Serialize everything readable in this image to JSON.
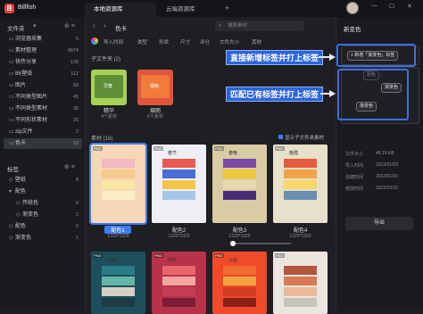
{
  "app": {
    "name": "Billfish",
    "logo": "B"
  },
  "tabs": [
    {
      "label": "本地资源库"
    },
    {
      "label": "云端资源库"
    }
  ],
  "window": {
    "add": "+",
    "min": "—",
    "max": "☐",
    "close": "✕"
  },
  "sidebar": {
    "folders_header": "文件夹",
    "folders_caret": "▾",
    "header_actions": "⊕ ≡",
    "folders": [
      {
        "label": "浏览器采集",
        "count": "5"
      },
      {
        "label": "素材整理",
        "count": "4874"
      },
      {
        "label": "快传分享",
        "count": "139"
      },
      {
        "label": "8K壁纸",
        "count": "112"
      },
      {
        "label": "图片",
        "count": "68"
      },
      {
        "label": "不同类型图片",
        "count": "45"
      },
      {
        "label": "不同类型素材",
        "count": "35"
      },
      {
        "label": "不同形状素材",
        "count": "26"
      },
      {
        "label": "zip文件",
        "count": "2"
      },
      {
        "label": "色卡",
        "count": "18"
      }
    ],
    "tags_header": "标签",
    "tags": [
      {
        "label": "壁纸",
        "count": "8"
      },
      {
        "label": "配色",
        "count": ""
      },
      {
        "label": "传统色",
        "count": "0"
      },
      {
        "label": "渐变色",
        "count": "1"
      },
      {
        "label": "配色",
        "count": "0"
      },
      {
        "label": "渐变色",
        "count": "1"
      }
    ]
  },
  "toolbar": {
    "back": "‹",
    "forward": "›",
    "breadcrumb": "色卡",
    "search_placeholder": "搜索素材",
    "search_icon": "⌕"
  },
  "filters": [
    "导入时间",
    "类型",
    "形状",
    "尺寸",
    "评分",
    "文件大小",
    "其他"
  ],
  "subfolders": {
    "title": "子文件夹 (2)",
    "items": [
      {
        "name": "精华",
        "count": "4个素材",
        "color": "#a8d255",
        "subtitle": "早春"
      },
      {
        "name": "烟雨",
        "count": "6个素材",
        "color": "#e0553c",
        "subtitle": "烟雨"
      }
    ]
  },
  "materials": {
    "title": "素材 (18)",
    "show_sub_label": "显示子文件夹素材",
    "cards": [
      {
        "label": "配色1",
        "size": "1320*1920",
        "bg": "#f5d8b8",
        "title": "",
        "badge": "PNG",
        "stripes": [
          "#f3b8c4",
          "#f6c98f",
          "#fbe5a2",
          "#f9eec4"
        ]
      },
      {
        "label": "配色2",
        "size": "1320*1920",
        "bg": "#f0eef5",
        "title": "春节",
        "badge": "PNG",
        "stripes": [
          "#e85a52",
          "#4a6ed6",
          "#f4c545",
          "#a4c7e8"
        ]
      },
      {
        "label": "配色3",
        "size": "1320*1920",
        "bg": "#d9cba3",
        "title": "春晚",
        "badge": "PNG",
        "stripes": [
          "#7a4aa5",
          "#f1c638",
          "#e8d9b0",
          "#4a2d7a"
        ]
      },
      {
        "label": "配色4",
        "size": "1320*1920",
        "bg": "#e8e0c8",
        "title": "晚霞",
        "badge": "PNG",
        "stripes": [
          "#e65a3f",
          "#f2a24a",
          "#f7d66a",
          "#6b8fb0"
        ]
      },
      {
        "label": "",
        "size": "",
        "bg": "#1d4f5c",
        "title": "侗族",
        "badge": "PNG",
        "stripes": [
          "#2a7d84",
          "#66b5a8",
          "#d4cfc4",
          "#1d3b44"
        ]
      },
      {
        "label": "",
        "size": "",
        "bg": "#b8324a",
        "title": "欢庆",
        "badge": "PNG",
        "stripes": [
          "#e8676b",
          "#f4a5a0",
          "#c43c55",
          "#7a1d35"
        ]
      },
      {
        "label": "",
        "size": "",
        "bg": "#f04a2a",
        "title": "火焰",
        "badge": "PNG",
        "stripes": [
          "#f26b2f",
          "#f7a23e",
          "#d43d24",
          "#8b1f18"
        ]
      },
      {
        "label": "",
        "size": "",
        "bg": "#ebe5df",
        "title": "",
        "badge": "PNG",
        "stripes": [
          "#b45540",
          "#d77a55",
          "#e9b99a",
          "#c3c6b8"
        ]
      }
    ]
  },
  "panel": {
    "name": "新变色",
    "add_tag_label": "+ 新增「渐变色」标签",
    "tag_placeholder": "配色",
    "tag_matched": "渐变色",
    "tag_matched2": "渐变色",
    "info": [
      {
        "k": "文件大小",
        "v": "48.19 KB"
      },
      {
        "k": "导入时间",
        "v": "2022/01/03"
      },
      {
        "k": "创建时间",
        "v": "2022/01/03"
      },
      {
        "k": "修改时间",
        "v": "2022/10/10"
      }
    ],
    "export_label": "导出"
  },
  "annotations": {
    "callout1": "直接新增标签并打上标签",
    "callout2": "匹配已有标签并打上标签"
  },
  "colors": {
    "accent": "#3d7bf0",
    "callout": "#2c64dc"
  }
}
